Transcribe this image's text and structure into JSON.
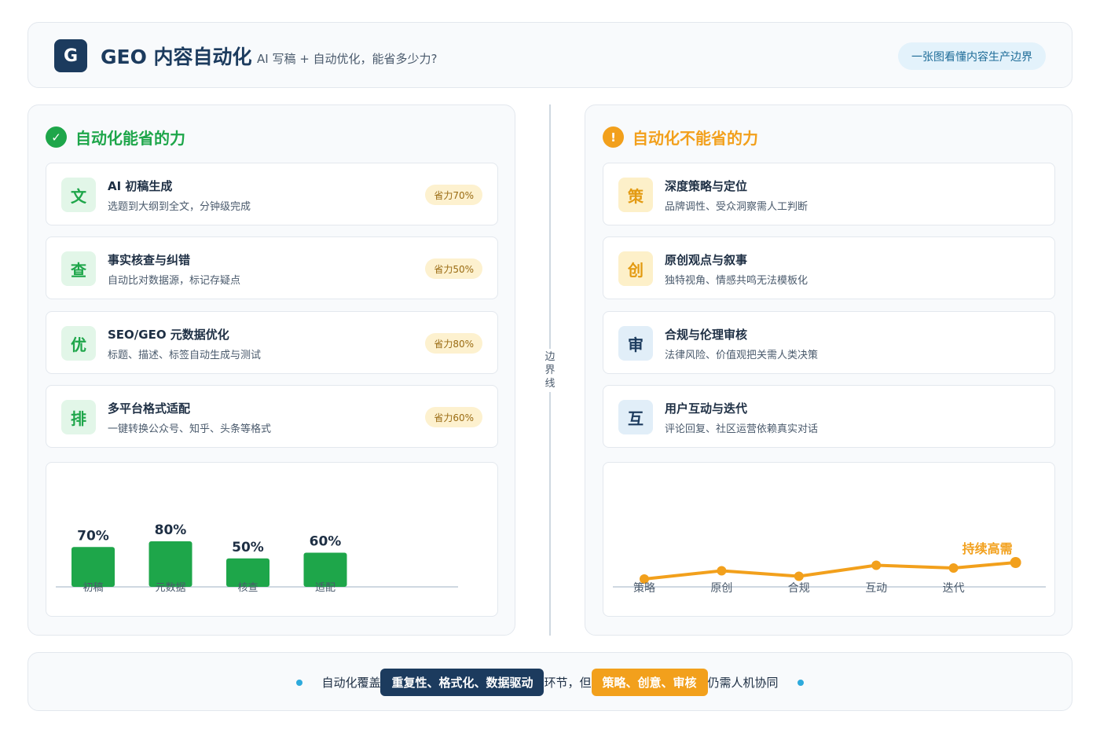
{
  "header": {
    "logo_letter": "G",
    "title": "GEO 内容自动化",
    "subtitle": "AI 写稿 + 自动优化，能省多少力?",
    "pill": "一张图看懂内容生产边界"
  },
  "left": {
    "heading": "自动化能省的力",
    "heading_icon": "check-icon",
    "heading_mark": "✓",
    "items": [
      {
        "icon": "文",
        "title": "AI 初稿生成",
        "desc": "选题到大纲到全文，分钟级完成",
        "badge": "省力70%"
      },
      {
        "icon": "查",
        "title": "事实核查与纠错",
        "desc": "自动比对数据源，标记存疑点",
        "badge": "省力50%"
      },
      {
        "icon": "优",
        "title": "SEO/GEO 元数据优化",
        "desc": "标题、描述、标签自动生成与测试",
        "badge": "省力80%"
      },
      {
        "icon": "排",
        "title": "多平台格式适配",
        "desc": "一键转换公众号、知乎、头条等格式",
        "badge": "省力60%"
      }
    ]
  },
  "divider_label": "边界线",
  "right": {
    "heading": "自动化不能省的力",
    "heading_icon": "warning-icon",
    "heading_mark": "!",
    "items": [
      {
        "icon": "策",
        "title": "深度策略与定位",
        "desc": "品牌调性、受众洞察需人工判断"
      },
      {
        "icon": "创",
        "title": "原创观点与叙事",
        "desc": "独特视角、情感共鸣无法模板化"
      },
      {
        "icon": "审",
        "title": "合规与伦理审核",
        "desc": "法律风险、价值观把关需人类决策"
      },
      {
        "icon": "互",
        "title": "用户互动与迭代",
        "desc": "评论回复、社区运营依赖真实对话"
      }
    ]
  },
  "chart_data": [
    {
      "type": "bar",
      "categories": [
        "初稿",
        "元数据",
        "核查",
        "适配"
      ],
      "values": [
        70,
        80,
        50,
        60
      ],
      "value_labels": [
        "70%",
        "80%",
        "50%",
        "60%"
      ],
      "ylim": [
        0,
        100
      ],
      "color": "#1ea64a"
    },
    {
      "type": "line",
      "categories": [
        "策略",
        "原创",
        "合规",
        "互动",
        "迭代"
      ],
      "values": [
        55,
        70,
        60,
        80,
        75,
        85
      ],
      "annotation": "持续高需",
      "ylim": [
        0,
        500
      ],
      "color": "#f2a01c"
    }
  ],
  "footer": {
    "lead": "自动化覆盖",
    "highlight_dark": "重复性、格式化、数据驱动",
    "middle": "环节，但",
    "highlight_orange": "策略、创意、审核",
    "tail": "仍需人机协同"
  },
  "colors": {
    "navy": "#1c3b5e",
    "green": "#1ea64a",
    "orange": "#f2a01c",
    "accent_blue": "#2eaadc"
  }
}
